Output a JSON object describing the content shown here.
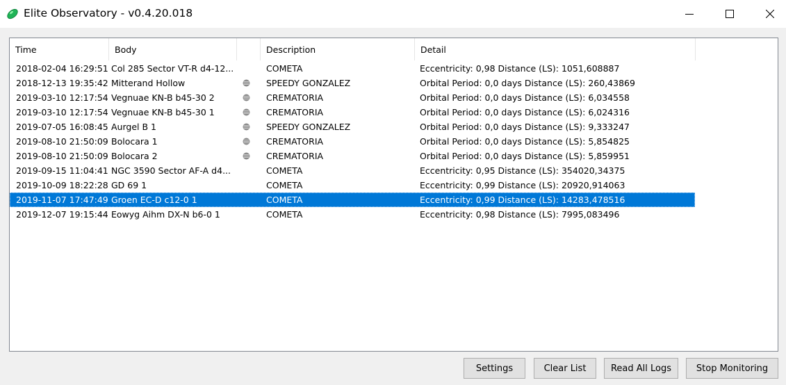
{
  "window": {
    "title": "Elite Observatory - v0.4.20.018",
    "app_icon": "elite-observatory-logo-icon",
    "controls": [
      "minimize-icon",
      "maximize-icon",
      "close-icon"
    ]
  },
  "list": {
    "columns": [
      "Time",
      "Body",
      "",
      "Description",
      "Detail"
    ],
    "selected_index": 9,
    "rows": [
      {
        "time": "2018-02-04 16:29:51",
        "body": "Col 285 Sector VT-R d4-12...",
        "icon": "",
        "description": "COMETA",
        "detail": "Eccentricity: 0,98 Distance (LS): 1051,608887"
      },
      {
        "time": "2018-12-13 19:35:42",
        "body": "Mitterand Hollow",
        "icon": "planet-icon",
        "description": "SPEEDY GONZALEZ",
        "detail": "Orbital Period: 0,0 days Distance (LS): 260,43869"
      },
      {
        "time": "2019-03-10 12:17:54",
        "body": "Vegnuae KN-B b45-30 2",
        "icon": "planet-icon",
        "description": "CREMATORIA",
        "detail": "Orbital Period: 0,0 days Distance (LS): 6,034558"
      },
      {
        "time": "2019-03-10 12:17:54",
        "body": "Vegnuae KN-B b45-30 1",
        "icon": "planet-icon",
        "description": "CREMATORIA",
        "detail": "Orbital Period: 0,0 days Distance (LS): 6,024316"
      },
      {
        "time": "2019-07-05 16:08:45",
        "body": "Aurgel B 1",
        "icon": "planet-icon",
        "description": "SPEEDY GONZALEZ",
        "detail": "Orbital Period: 0,0 days Distance (LS): 9,333247"
      },
      {
        "time": "2019-08-10 21:50:09",
        "body": "Bolocara 1",
        "icon": "planet-icon",
        "description": "CREMATORIA",
        "detail": "Orbital Period: 0,0 days Distance (LS): 5,854825"
      },
      {
        "time": "2019-08-10 21:50:09",
        "body": "Bolocara 2",
        "icon": "planet-icon",
        "description": "CREMATORIA",
        "detail": "Orbital Period: 0,0 days Distance (LS): 5,859951"
      },
      {
        "time": "2019-09-15 11:04:41",
        "body": "NGC 3590 Sector AF-A d4...",
        "icon": "",
        "description": "COMETA",
        "detail": "Eccentricity: 0,95 Distance (LS): 354020,34375"
      },
      {
        "time": "2019-10-09 18:22:28",
        "body": "GD 69 1",
        "icon": "",
        "description": "COMETA",
        "detail": "Eccentricity: 0,99 Distance (LS): 20920,914063"
      },
      {
        "time": "2019-11-07 17:47:49",
        "body": "Groen EC-D c12-0 1",
        "icon": "",
        "description": "COMETA",
        "detail": "Eccentricity: 0,99 Distance (LS): 14283,478516"
      },
      {
        "time": "2019-12-07 19:15:44",
        "body": "Eowyg Aihm DX-N b6-0 1",
        "icon": "",
        "description": "COMETA",
        "detail": "Eccentricity: 0,98 Distance (LS): 7995,083496"
      }
    ]
  },
  "buttons": {
    "settings": "Settings",
    "clear_list": "Clear List",
    "read_all_logs": "Read All Logs",
    "stop_monitoring": "Stop Monitoring"
  },
  "colors": {
    "selection": "#0078d7",
    "window_bg": "#f0f0f0",
    "list_bg": "#ffffff"
  }
}
